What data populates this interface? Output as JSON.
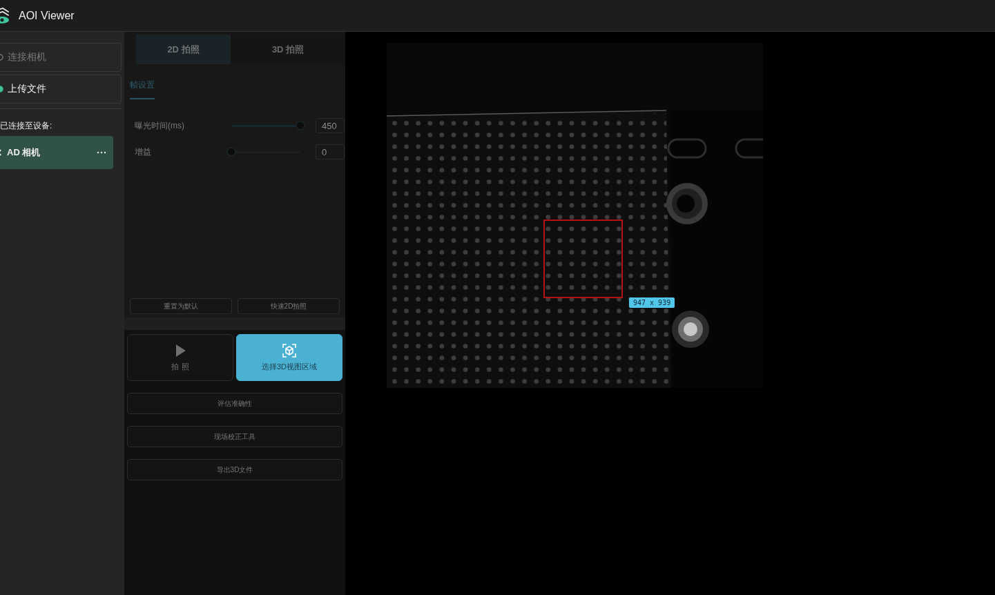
{
  "app": {
    "title": "AOI Viewer"
  },
  "sidebar": {
    "actions": [
      {
        "label": "连接相机",
        "disabled": true
      },
      {
        "label": "上传文件",
        "disabled": false
      }
    ],
    "connected_label": "已连接至设备:",
    "devices": [
      {
        "name": "AD 相机",
        "selected": true
      }
    ]
  },
  "capture_tabs": [
    {
      "label": "2D 拍照",
      "selected": true
    },
    {
      "label": "3D 拍照",
      "selected": false
    }
  ],
  "settings_tabs": [
    {
      "label": "帧设置",
      "selected": true
    }
  ],
  "settings": [
    {
      "label": "曝光时间(ms)",
      "level": 1,
      "value": "450"
    },
    {
      "label": "增益",
      "level": 0,
      "value": "0"
    }
  ],
  "settings_buttons": [
    "重置为默认",
    "快速2D拍照"
  ],
  "action_tiles": [
    {
      "label": "拍 照",
      "kind": "play",
      "selected": false
    },
    {
      "label": "选择3D视图区域",
      "kind": "cube",
      "selected": true
    }
  ],
  "tools": [
    "评估准确性",
    "现场校正工具",
    "导出3D文件"
  ],
  "viewer": {
    "selection_size": "947 x 939"
  }
}
